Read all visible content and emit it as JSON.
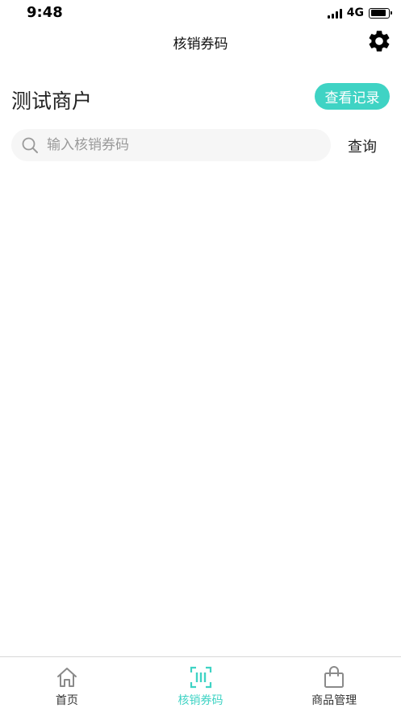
{
  "status_bar": {
    "time": "9:48",
    "network": "4G",
    "battery_level": 0.9
  },
  "nav": {
    "title": "核销券码",
    "settings_icon": "gear-icon"
  },
  "merchant": {
    "name": "测试商户",
    "records_label": "查看记录"
  },
  "search": {
    "placeholder": "输入核销券码",
    "value": "",
    "query_label": "查询"
  },
  "tabs": [
    {
      "label": "首页",
      "icon": "home-icon",
      "active": false
    },
    {
      "label": "核销券码",
      "icon": "scan-code-icon",
      "active": true
    },
    {
      "label": "商品管理",
      "icon": "shopping-bag-icon",
      "active": false
    }
  ],
  "colors": {
    "accent": "#3fd3c4",
    "search_bg": "#f6f6f6",
    "text": "#222222"
  }
}
